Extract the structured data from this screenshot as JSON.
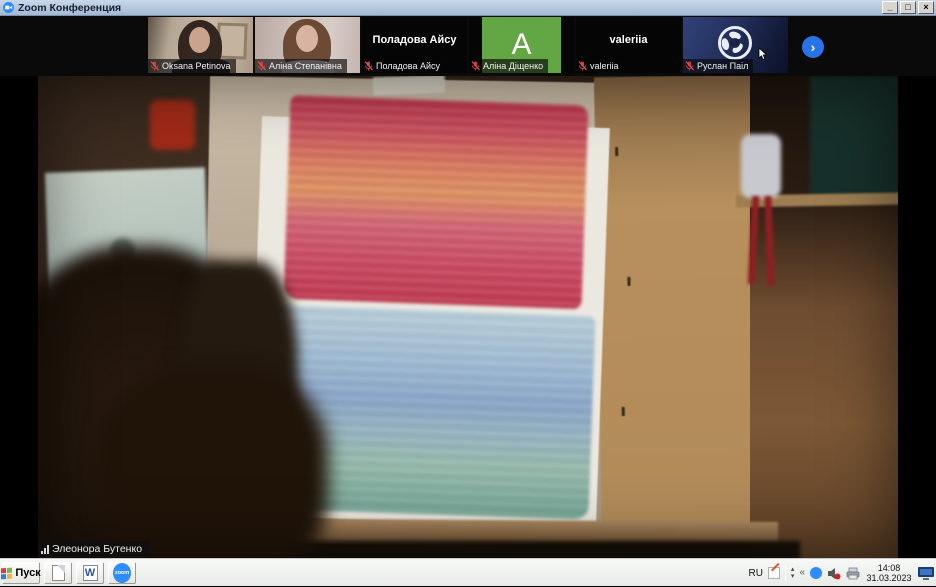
{
  "window": {
    "title": "Zoom Конференция",
    "controls": {
      "minimize": "_",
      "restore": "□",
      "close": "×"
    }
  },
  "participants_strip": {
    "next_button": "›",
    "participants": [
      {
        "label": "Oksana Petinova",
        "muted": true,
        "tile": "video"
      },
      {
        "label": "Аліна Степанівна",
        "muted": true,
        "tile": "video"
      },
      {
        "label": "Поладова Айсу",
        "muted": true,
        "tile": "name",
        "display_name": "Поладова Айсу"
      },
      {
        "label": "Аліна Діщенко",
        "muted": true,
        "tile": "avatar",
        "avatar_letter": "A",
        "avatar_color": "#62a744"
      },
      {
        "label": "valeriia",
        "muted": true,
        "tile": "name",
        "display_name": "valeriia"
      },
      {
        "label": "Руслан Паіл",
        "muted": true,
        "tile": "obs-logo"
      }
    ]
  },
  "main_video": {
    "speaker_label": "Элеонора Бутенко",
    "connection_icon": "signal-bars",
    "scene_description": "easel with watercolor painting: red-orange washes on top, blue-green washes below"
  },
  "taskbar": {
    "start_button": "Пуск",
    "app_buttons": [
      {
        "name": "document"
      },
      {
        "name": "word",
        "letter": "W"
      },
      {
        "name": "zoom",
        "label": "zoom"
      }
    ],
    "tray": {
      "language": "RU",
      "time": "14:08",
      "date": "31.03.2023"
    }
  },
  "colors": {
    "accent_blue": "#2a72e8",
    "zoom_blue": "#2d8cff",
    "muted_mic_red": "#d43c3c",
    "avatar_green": "#62a744",
    "titlebar": "#b7cbe3",
    "taskbar_bg": "#eef0ee"
  }
}
